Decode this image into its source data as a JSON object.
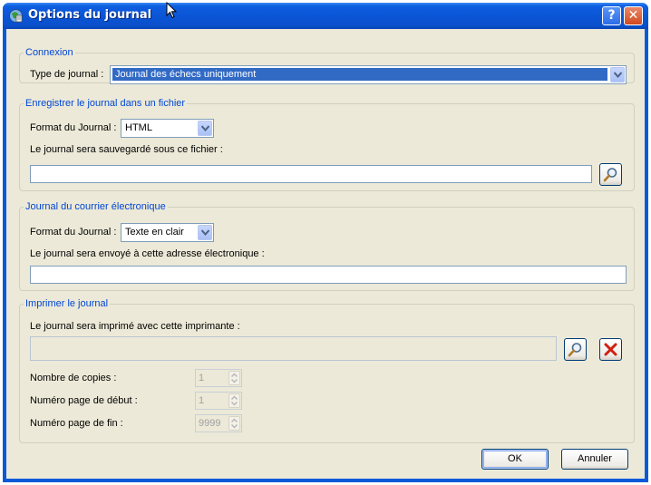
{
  "window": {
    "title": "Options du journal",
    "help_glyph": "?",
    "close_glyph": "✕"
  },
  "connexion": {
    "legend": "Connexion",
    "type_label": "Type de journal :",
    "type_value": "Journal des échecs uniquement"
  },
  "file": {
    "legend": "Enregistrer le journal dans un fichier",
    "format_label": "Format du Journal :",
    "format_value": "HTML",
    "path_label": "Le journal sera sauvegardé sous ce fichier :",
    "path_value": ""
  },
  "email": {
    "legend": "Journal du courrier électronique",
    "format_label": "Format du Journal :",
    "format_value": "Texte en clair",
    "address_label": "Le journal sera envoyé à cette adresse électronique :",
    "address_value": ""
  },
  "print": {
    "legend": "Imprimer le journal",
    "printer_label": "Le journal sera imprimé avec cette imprimante :",
    "printer_value": "",
    "copies_label": "Nombre de copies :",
    "copies_value": "1",
    "start_label": "Numéro page de début :",
    "start_value": "1",
    "end_label": "Numéro page de fin :",
    "end_value": "9999"
  },
  "buttons": {
    "ok": "OK",
    "cancel": "Annuler"
  },
  "colors": {
    "titlebar": "#0a55d6",
    "legend": "#0046d5",
    "selection": "#316ac5",
    "dialog_bg": "#ece9d8"
  }
}
